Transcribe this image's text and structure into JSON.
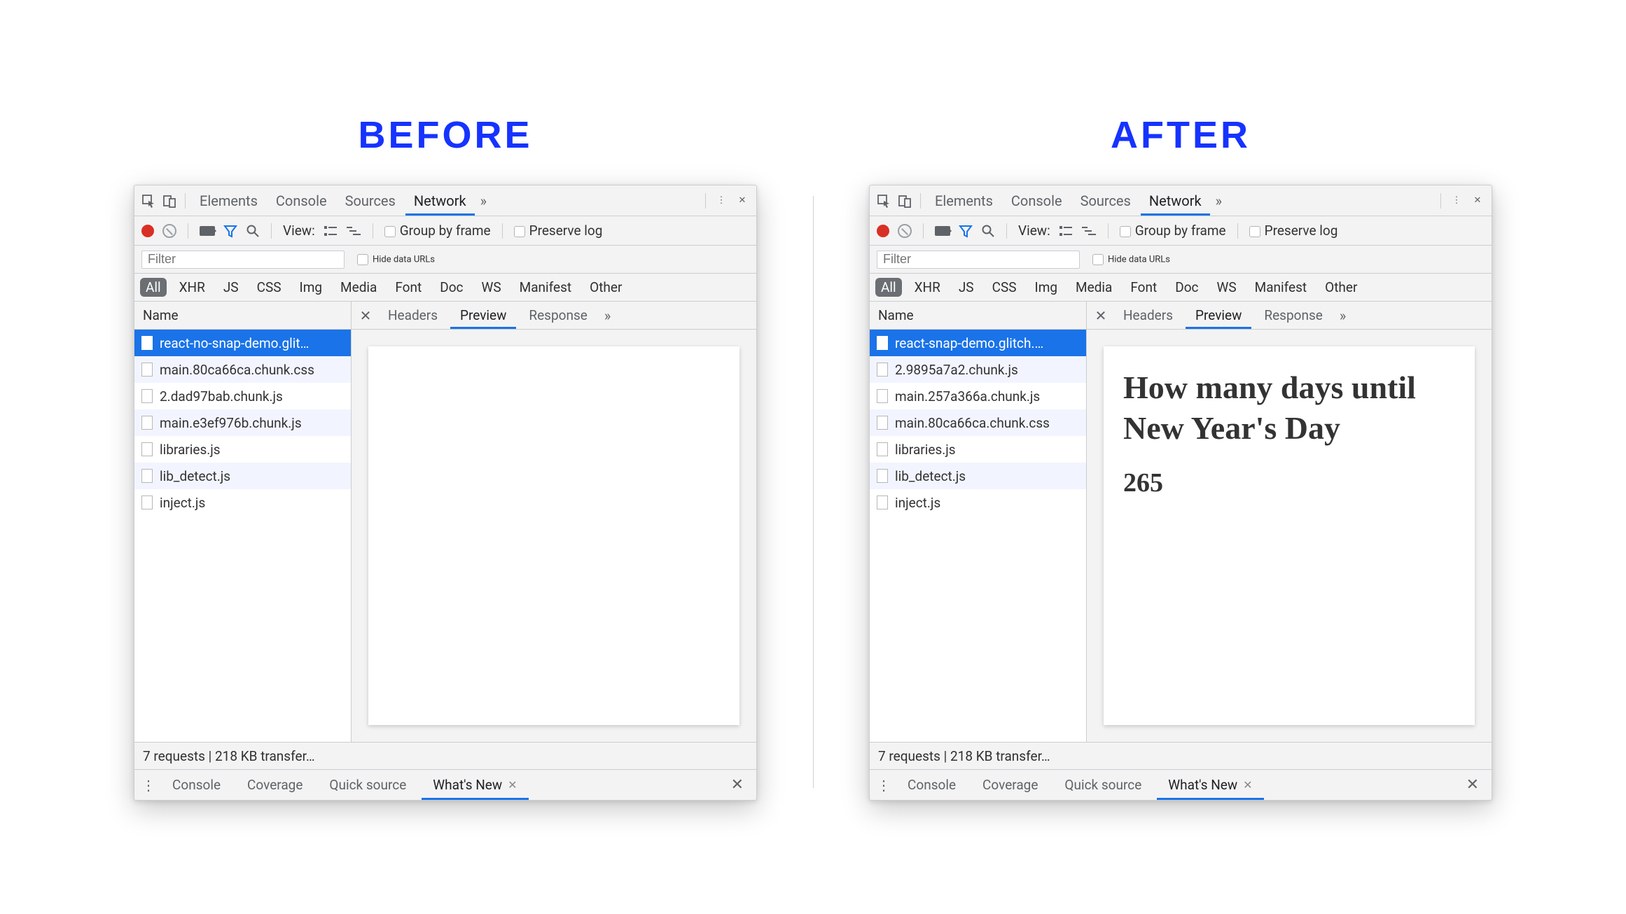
{
  "headings": {
    "before": "BEFORE",
    "after": "AFTER"
  },
  "common": {
    "top_tabs": {
      "elements": "Elements",
      "console": "Console",
      "sources": "Sources",
      "network": "Network"
    },
    "toolbar": {
      "view_label": "View:",
      "group_by_frame": "Group by frame",
      "preserve_log": "Preserve log"
    },
    "filterbar": {
      "placeholder": "Filter",
      "hide_data_urls": "Hide data URLs"
    },
    "types": {
      "all": "All",
      "xhr": "XHR",
      "js": "JS",
      "css": "CSS",
      "img": "Img",
      "media": "Media",
      "font": "Font",
      "doc": "Doc",
      "ws": "WS",
      "manifest": "Manifest",
      "other": "Other"
    },
    "reqlist_header": "Name",
    "detail_tabs": {
      "headers": "Headers",
      "preview": "Preview",
      "response": "Response"
    },
    "status": "7 requests | 218 KB transfer…",
    "drawer": {
      "console": "Console",
      "coverage": "Coverage",
      "quick_source": "Quick source",
      "whats_new": "What's New"
    }
  },
  "before": {
    "requests": [
      "react-no-snap-demo.glit…",
      "main.80ca66ca.chunk.css",
      "2.dad97bab.chunk.js",
      "main.e3ef976b.chunk.js",
      "libraries.js",
      "lib_detect.js",
      "inject.js"
    ],
    "preview": {
      "title": "",
      "count": ""
    }
  },
  "after": {
    "requests": [
      "react-snap-demo.glitch.…",
      "2.9895a7a2.chunk.js",
      "main.257a366a.chunk.js",
      "main.80ca66ca.chunk.css",
      "libraries.js",
      "lib_detect.js",
      "inject.js"
    ],
    "preview": {
      "title": "How many days until New Year's Day",
      "count": "265"
    }
  }
}
